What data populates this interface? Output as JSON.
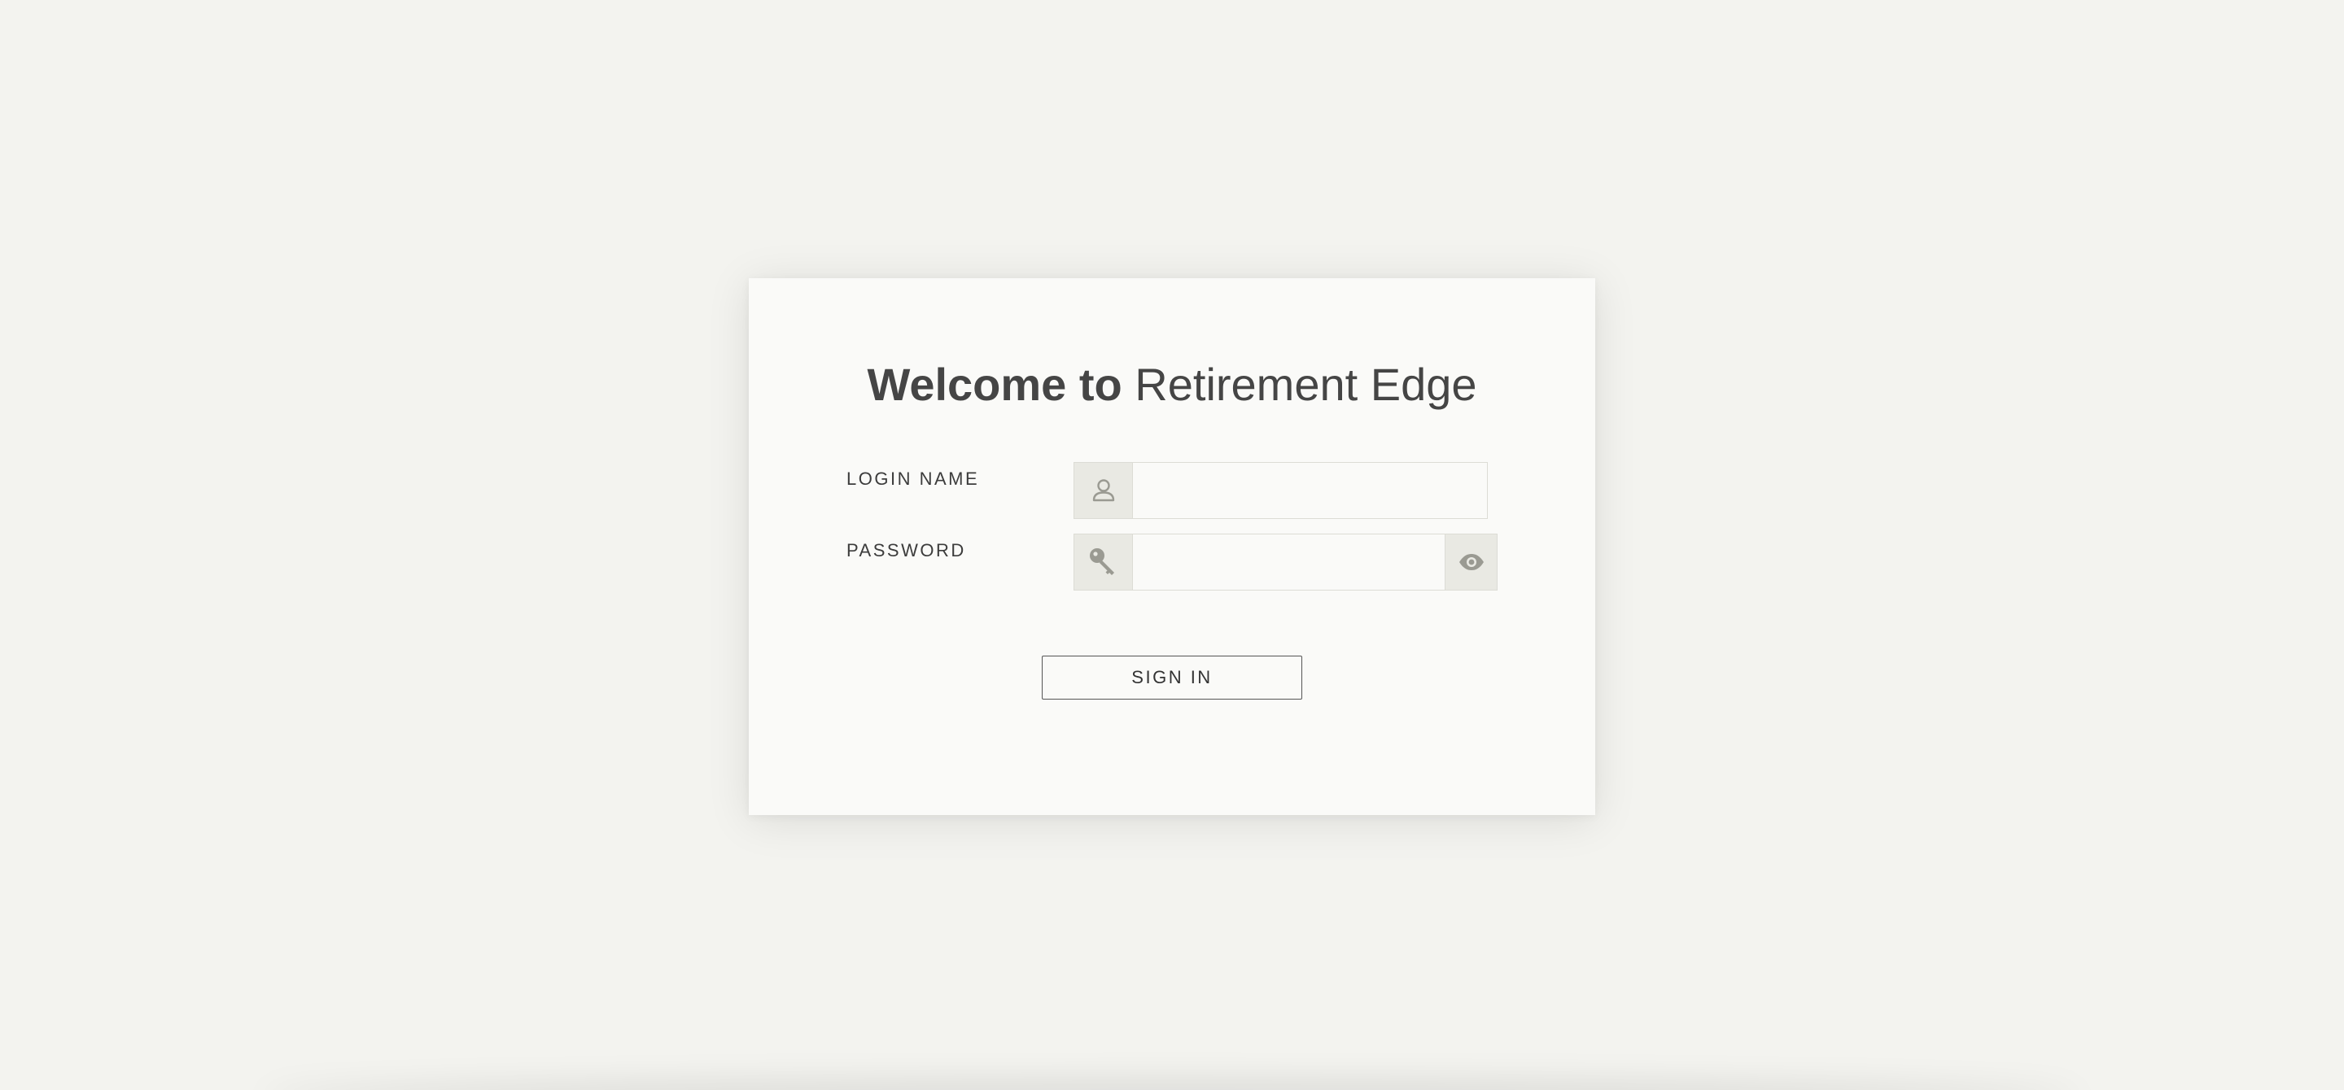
{
  "title": {
    "bold_part": "Welcome to",
    "light_part": "Retirement Edge"
  },
  "form": {
    "login_name_label": "LOGIN NAME",
    "login_name_value": "",
    "login_name_icon": "user-icon",
    "password_label": "PASSWORD",
    "password_value": "",
    "password_icon": "key-icon",
    "password_toggle_icon": "eye-icon",
    "signin_label": "SIGN IN"
  },
  "colors": {
    "page_background": "#f3f3ef",
    "card_background": "#fafaf8",
    "addon_background": "#e9e9e3",
    "text": "#444444",
    "icon": "#9a9a92"
  }
}
